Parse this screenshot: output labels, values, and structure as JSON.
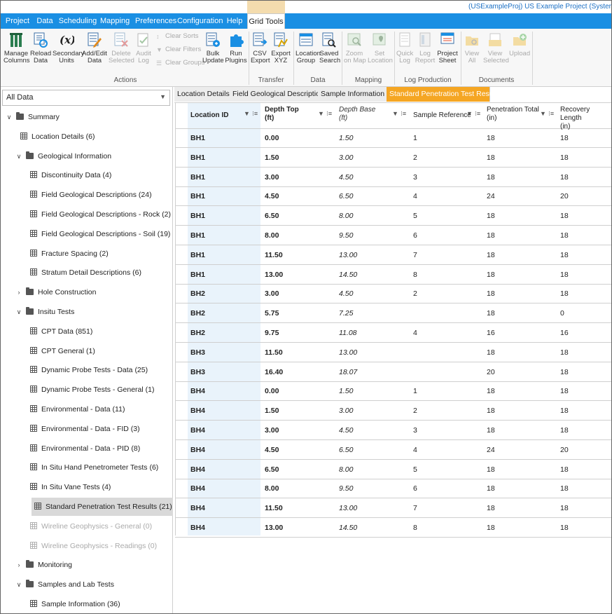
{
  "window": {
    "project_label": "(USExampleProj) US Example Project (Syster"
  },
  "menu": {
    "items": [
      "Project",
      "Data",
      "Scheduling",
      "Mapping",
      "Preferences",
      "Configuration",
      "Help",
      "Grid Tools"
    ],
    "active": "Grid Tools"
  },
  "ribbon": {
    "actions": {
      "manage_columns": "Manage\nColumns",
      "reload_data": "Reload\nData",
      "secondary_units": "Secondary\nUnits",
      "add_edit_data": "Add/Edit\nData",
      "delete_selected": "Delete\nSelected",
      "audit_log": "Audit\nLog",
      "clear_sorts": "Clear Sorts",
      "clear_filters": "Clear Filters",
      "clear_groups": "Clear Groups",
      "bulk_update": "Bulk\nUpdate",
      "run_plugins": "Run\nPlugins",
      "group_label": "Actions"
    },
    "transfer": {
      "csv_export": "CSV\nExport",
      "export_xyz": "Export\nXYZ",
      "group_label": "Transfer"
    },
    "data": {
      "location_group": "Location\nGroup",
      "saved_search": "Saved\nSearch",
      "group_label": "Data"
    },
    "mapping": {
      "zoom_on_map": "Zoom\non Map",
      "set_location": "Set\nLocation",
      "group_label": "Mapping"
    },
    "log_production": {
      "quick_log": "Quick\nLog",
      "log_report": "Log\nReport",
      "project_sheet": "Project\nSheet",
      "group_label": "Log Production"
    },
    "documents": {
      "view_all": "View\nAll",
      "view_selected": "View\nSelected",
      "upload": "Upload",
      "group_label": "Documents"
    }
  },
  "left_panel": {
    "dropdown_value": "All Data",
    "tree": [
      {
        "label": "Summary",
        "type": "folder",
        "level": 0,
        "expander": "v"
      },
      {
        "label": "Location Details (6)",
        "type": "table",
        "level": 1
      },
      {
        "label": "Geological Information",
        "type": "folder",
        "level": 1,
        "expander": "v"
      },
      {
        "label": "Discontinuity Data (4)",
        "type": "table",
        "level": 2
      },
      {
        "label": "Field Geological Descriptions (24)",
        "type": "table",
        "level": 2
      },
      {
        "label": "Field Geological Descriptions - Rock (2)",
        "type": "table",
        "level": 2
      },
      {
        "label": "Field Geological Descriptions - Soil (19)",
        "type": "table",
        "level": 2
      },
      {
        "label": "Fracture Spacing (2)",
        "type": "table",
        "level": 2
      },
      {
        "label": "Stratum Detail Descriptions (6)",
        "type": "table",
        "level": 2
      },
      {
        "label": "Hole Construction",
        "type": "folder",
        "level": 1,
        "expander": ">"
      },
      {
        "label": "Insitu Tests",
        "type": "folder",
        "level": 1,
        "expander": "v"
      },
      {
        "label": "CPT Data (851)",
        "type": "table",
        "level": 2
      },
      {
        "label": "CPT General (1)",
        "type": "table",
        "level": 2
      },
      {
        "label": "Dynamic Probe Tests - Data (25)",
        "type": "table",
        "level": 2
      },
      {
        "label": "Dynamic Probe Tests - General (1)",
        "type": "table",
        "level": 2
      },
      {
        "label": "Environmental - Data (11)",
        "type": "table",
        "level": 2
      },
      {
        "label": "Environmental - Data - FID (3)",
        "type": "table",
        "level": 2
      },
      {
        "label": "Environmental - Data - PID (8)",
        "type": "table",
        "level": 2
      },
      {
        "label": "In Situ Hand Penetrometer Tests (6)",
        "type": "table",
        "level": 2
      },
      {
        "label": "In Situ Vane Tests (4)",
        "type": "table",
        "level": 2
      },
      {
        "label": "Standard Penetration Test Results (21)",
        "type": "table",
        "level": 2,
        "selected": true
      },
      {
        "label": "Wireline Geophysics - General (0)",
        "type": "table",
        "level": 2,
        "dim": true
      },
      {
        "label": "Wireline Geophysics - Readings (0)",
        "type": "table",
        "level": 2,
        "dim": true
      },
      {
        "label": "Monitoring",
        "type": "folder",
        "level": 1,
        "expander": ">"
      },
      {
        "label": "Samples and Lab Tests",
        "type": "folder",
        "level": 1,
        "expander": "v"
      },
      {
        "label": "Sample Information (36)",
        "type": "table",
        "level": 2
      }
    ]
  },
  "tabs": [
    {
      "label": "Location Details"
    },
    {
      "label": "Field Geological Descriptions"
    },
    {
      "label": "Sample Information"
    },
    {
      "label": "Standard Penetration Test Results",
      "active": true
    }
  ],
  "tab_close": "×",
  "grid": {
    "columns": [
      {
        "label": "Location ID",
        "unit": ""
      },
      {
        "label": "Depth Top",
        "unit": "(ft)"
      },
      {
        "label": "Depth Base",
        "unit": "(ft)"
      },
      {
        "label": "Sample Reference",
        "unit": ""
      },
      {
        "label": "Penetration Total",
        "unit": "(in)"
      },
      {
        "label": "Recovery Length",
        "unit": "(in)"
      }
    ],
    "rows": [
      [
        "BH1",
        "0.00",
        "1.50",
        "1",
        "18",
        "18"
      ],
      [
        "BH1",
        "1.50",
        "3.00",
        "2",
        "18",
        "18"
      ],
      [
        "BH1",
        "3.00",
        "4.50",
        "3",
        "18",
        "18"
      ],
      [
        "BH1",
        "4.50",
        "6.50",
        "4",
        "24",
        "20"
      ],
      [
        "BH1",
        "6.50",
        "8.00",
        "5",
        "18",
        "18"
      ],
      [
        "BH1",
        "8.00",
        "9.50",
        "6",
        "18",
        "18"
      ],
      [
        "BH1",
        "11.50",
        "13.00",
        "7",
        "18",
        "18"
      ],
      [
        "BH1",
        "13.00",
        "14.50",
        "8",
        "18",
        "18"
      ],
      [
        "BH2",
        "3.00",
        "4.50",
        "2",
        "18",
        "18"
      ],
      [
        "BH2",
        "5.75",
        "7.25",
        "",
        "18",
        "0"
      ],
      [
        "BH2",
        "9.75",
        "11.08",
        "4",
        "16",
        "16"
      ],
      [
        "BH3",
        "11.50",
        "13.00",
        "",
        "18",
        "18"
      ],
      [
        "BH3",
        "16.40",
        "18.07",
        "",
        "20",
        "18"
      ],
      [
        "BH4",
        "0.00",
        "1.50",
        "1",
        "18",
        "18"
      ],
      [
        "BH4",
        "1.50",
        "3.00",
        "2",
        "18",
        "18"
      ],
      [
        "BH4",
        "3.00",
        "4.50",
        "3",
        "18",
        "18"
      ],
      [
        "BH4",
        "4.50",
        "6.50",
        "4",
        "24",
        "20"
      ],
      [
        "BH4",
        "6.50",
        "8.00",
        "5",
        "18",
        "18"
      ],
      [
        "BH4",
        "8.00",
        "9.50",
        "6",
        "18",
        "18"
      ],
      [
        "BH4",
        "11.50",
        "13.00",
        "7",
        "18",
        "18"
      ],
      [
        "BH4",
        "13.00",
        "14.50",
        "8",
        "18",
        "18"
      ]
    ]
  },
  "colors": {
    "menubar": "#1a8fe3",
    "active_tab": "#f5a623",
    "selected_tree_item": "#d9d9d9",
    "location_column_bg": "#e9f3fb"
  }
}
